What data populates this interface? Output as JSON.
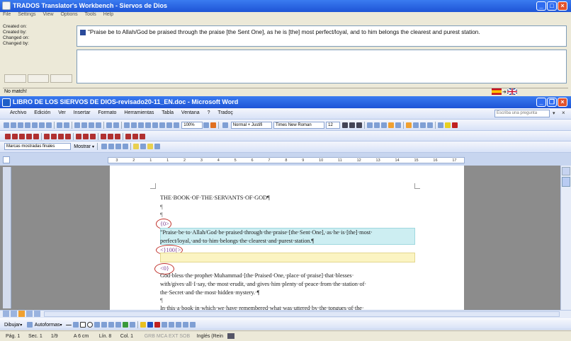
{
  "trados": {
    "title": "TRADOS Translator's Workbench - Siervos de Dios",
    "menu": [
      "File",
      "Settings",
      "View",
      "Options",
      "Tools",
      "Help"
    ],
    "meta_labels": [
      "Created on:",
      "Created by:",
      "Changed on:",
      "Changed by:"
    ],
    "segment_text": "\"Praise be to Allah/God be praised through the praise [the Sent One], as he is [the] most perfect/loyal, and to him belongs the clearest and purest station.",
    "status": "No match!"
  },
  "word": {
    "title": "LIBRO DE LOS SIERVOS DE DIOS-revisado20-11_EN.doc - Microsoft Word",
    "menu": [
      "Archivo",
      "Edición",
      "Ver",
      "Insertar",
      "Formato",
      "Herramientas",
      "Tabla",
      "Ventana",
      "?",
      "Tradoç"
    ],
    "help_placeholder": "Escriba una pregunta",
    "zoom": "100%",
    "style": "Normal + Justifi",
    "font": "Times New Roman",
    "font_size": "12",
    "markup_select": "Marcas mostradas finales",
    "show_button": "Mostrar",
    "ruler_numbers": [
      "3",
      "2",
      "1",
      "1",
      "2",
      "3",
      "4",
      "5",
      "6",
      "7",
      "8",
      "9",
      "10",
      "11",
      "12",
      "13",
      "14",
      "15",
      "16",
      "17"
    ],
    "doc": {
      "heading": "THE·BOOK·OF·THE·SERVANTS·OF·GOD¶",
      "pilcrow": "¶",
      "tag1": "{0>",
      "seg_line1": "\"Praise·be·to·Allah/God·be·praised·through·the·praise·[the·Sent·One],·as·he·is·[the]·most·",
      "seg_line2": "perfect/loyal,·and·to·him·belongs·the·clearest·and·purest·station.¶",
      "tag2": "<}100{>",
      "tag3": "<0}",
      "p2_line1": "God·bless·the·prophet·Muhammad·[the·Praised·One,·place·of·praise]·that·blesses·",
      "p2_line2": "with/gives·all·I·say,·the·most·erudit,·and·gives·him·plenty·of·peace·from·the·station·of·",
      "p2_line3": "the·Secret·and·the·most·hidden·mystery.·¶",
      "p3_line1": "In·this·a·book·in·which·we·have·remembered·what·was·uttered·by·the·tongues·of·the·"
    },
    "drawing": {
      "draw_label": "Dibujar",
      "autoshapes_label": "Autoformas"
    },
    "status": {
      "page": "Pág. 1",
      "section": "Sec. 1",
      "pages": "1/9",
      "at": "A 6 cm",
      "line": "Lín. 8",
      "col": "Col. 1",
      "modes": "GRB  MCA  EXT  SOB",
      "language": "Inglés (Rein"
    }
  },
  "colors": {
    "title_blue": "#2058d8",
    "highlight_cyan": "#cdeef2",
    "highlight_yellow": "#fbf4c2",
    "annotation_red": "#c0312a"
  }
}
